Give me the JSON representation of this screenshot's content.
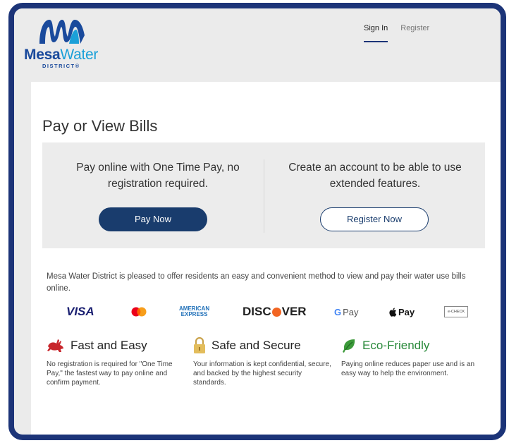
{
  "brand": {
    "name_part1": "Mesa",
    "name_part2": "Water",
    "sub": "DISTRICT®"
  },
  "nav": {
    "items": [
      {
        "label": "Sign In",
        "active": true
      },
      {
        "label": "Register",
        "active": false
      }
    ]
  },
  "page": {
    "title": "Pay or View Bills"
  },
  "options": {
    "left": {
      "text": "Pay online with One Time Pay, no registration required.",
      "button": "Pay Now"
    },
    "right": {
      "text": "Create an account to be able to use extended features.",
      "button": "Register Now"
    }
  },
  "intro": "Mesa Water District is pleased to offer residents an easy and convenient method to view and pay their water use bills online.",
  "payment_methods": {
    "visa": "VISA",
    "mastercard": "mastercard-logo",
    "amex_line1": "AMERICAN",
    "amex_line2": "EXPRESS",
    "discover_a": "DISC",
    "discover_b": "VER",
    "gpay_g": "G",
    "gpay_text": "Pay",
    "applepay": "Pay",
    "echeck": "e-CHECK"
  },
  "features": [
    {
      "title": "Fast and Easy",
      "icon": "rabbit-icon",
      "desc": "No registration is required for \"One Time Pay,\" the fastest way to pay online and confirm payment."
    },
    {
      "title": "Safe and Secure",
      "icon": "padlock-icon",
      "desc": "Your information is kept confidential, secure, and backed by the highest security standards."
    },
    {
      "title": "Eco-Friendly",
      "icon": "leaf-icon",
      "desc": "Paying online reduces paper use and is an easy way to help the environment."
    }
  ],
  "colors": {
    "frame": "#1c3478",
    "primary_button": "#193c6d",
    "brand_blue": "#1a4a9c",
    "brand_light": "#1ba0d8",
    "eco_green": "#2a8a3b",
    "rabbit_red": "#c8262c"
  }
}
